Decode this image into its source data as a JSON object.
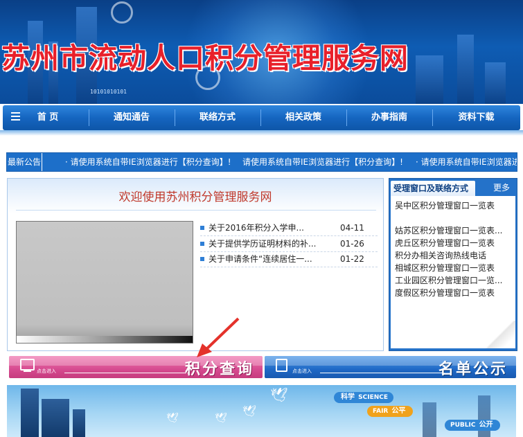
{
  "site_title": "苏州市流动人口积分管理服务网",
  "banner_digits": "10101010101",
  "nav": {
    "items": [
      {
        "label": "首 页",
        "name": "nav-home"
      },
      {
        "label": "通知通告",
        "name": "nav-notices"
      },
      {
        "label": "联络方式",
        "name": "nav-contact"
      },
      {
        "label": "相关政策",
        "name": "nav-policy"
      },
      {
        "label": "办事指南",
        "name": "nav-guide"
      },
      {
        "label": "资料下载",
        "name": "nav-downloads"
      }
    ]
  },
  "notice": {
    "label": "最新公告",
    "items": [
      "· 请使用系统自带IE浏览器进行【积分查询】!",
      "请使用系统自带IE浏览器进行【积分查询】!",
      "· 请使用系统自带IE浏览器进行【积分查询】!"
    ]
  },
  "welcome": {
    "title": "欢迎使用苏州积分管理服务网",
    "news": [
      {
        "title": "关于2016年积分入学申...",
        "date": "04-11"
      },
      {
        "title": "关于提供学历证明材料的补...",
        "date": "01-26"
      },
      {
        "title": "关于申请条件“连续居住一...",
        "date": "01-22"
      }
    ]
  },
  "side": {
    "title": "受理窗口及联络方式",
    "more": "更多",
    "items": [
      "吴中区积分管理窗口一览表",
      "姑苏区积分管理窗口一览表...",
      "虎丘区积分管理窗口一览表",
      "积分办相关咨询热线电话",
      "相城区积分管理窗口一览表",
      "工业园区积分管理窗口一览...",
      "度假区积分管理窗口一览表"
    ]
  },
  "entries": {
    "score": {
      "small": "点击进入",
      "big": "积分查询",
      "color": "#d64b90"
    },
    "list": {
      "small": "点击进入",
      "big": "名单公示",
      "color": "#1f69c6"
    }
  },
  "bottom": {
    "pills": [
      {
        "cn": "科学",
        "en": "SCIENCE"
      },
      {
        "cn": "公平",
        "en": "FAIR"
      },
      {
        "cn": "公开",
        "en": "PUBLIC"
      }
    ]
  },
  "colors": {
    "primary_blue": "#1d6fc9",
    "title_red": "#e8202a",
    "welcome_red": "#c0392b"
  }
}
